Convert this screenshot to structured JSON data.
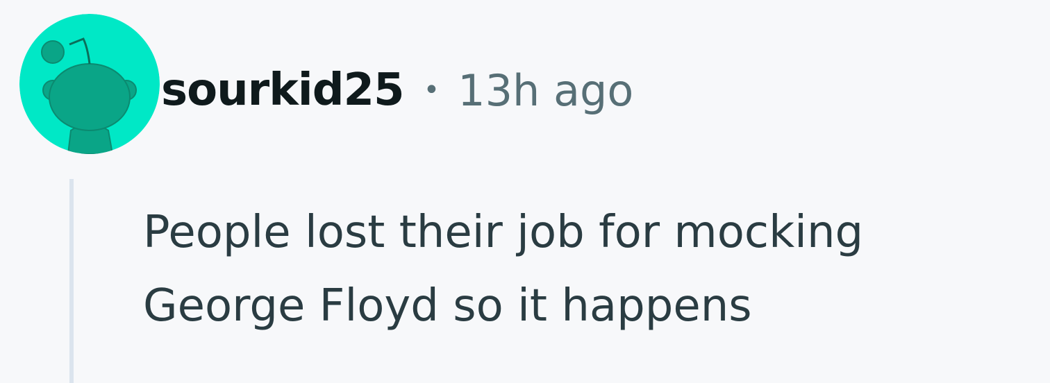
{
  "comment": {
    "author": "sourkid25",
    "separator": "•",
    "time_ago": "13h ago",
    "body_lines": [
      "People lost their job for mocking",
      "George Floyd so it happens"
    ]
  },
  "avatar": {
    "icon": "snoo-avatar-icon",
    "background_color": "#00e8c6",
    "figure_color": "#0aa587"
  },
  "colors": {
    "page_background": "#f7f8fa",
    "author_text": "#0f1a1c",
    "meta_text": "#576f76",
    "body_text": "#2a3c42",
    "thread_line": "#dbe4ee"
  }
}
